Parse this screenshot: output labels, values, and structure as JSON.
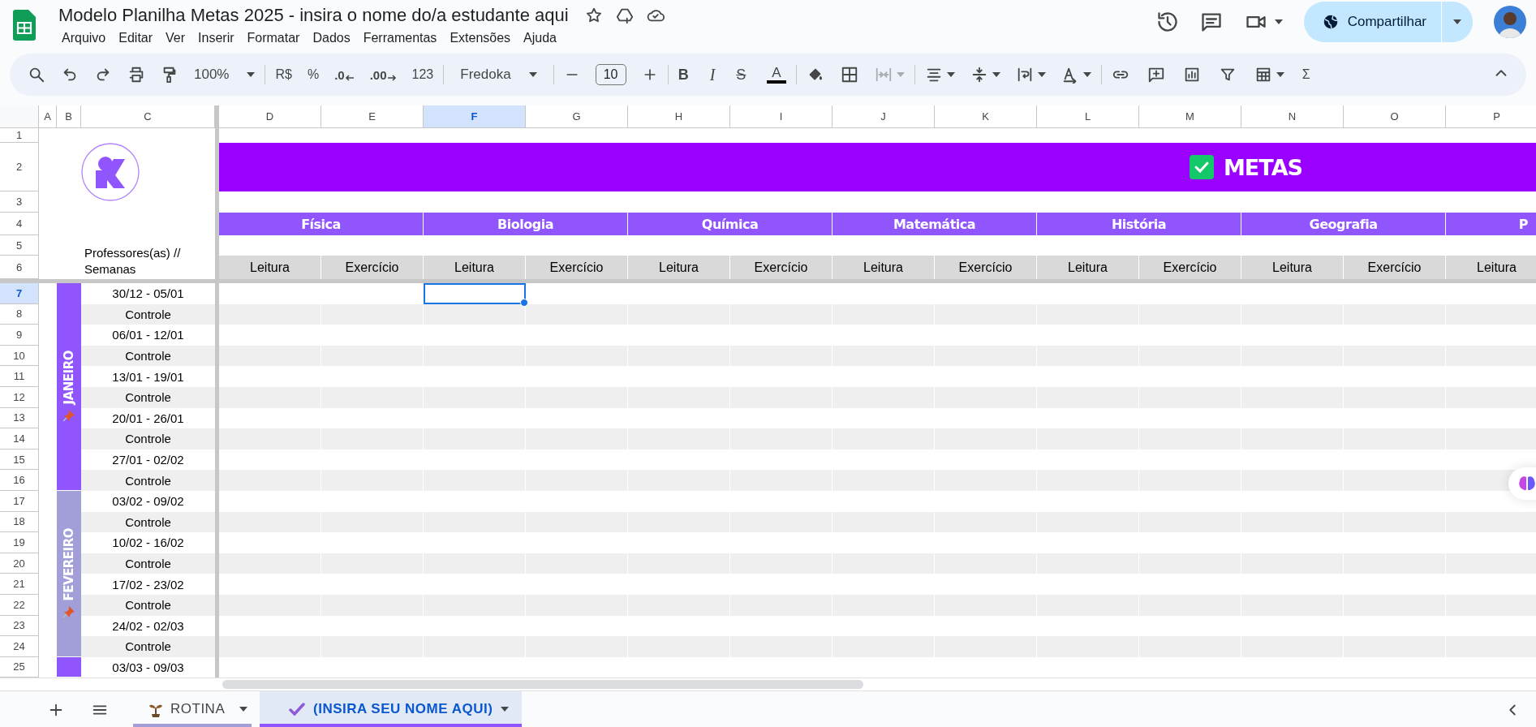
{
  "document": {
    "title": "Modelo Planilha Metas 2025 - insira o nome do/a estudante aqui"
  },
  "menu": [
    "Arquivo",
    "Editar",
    "Ver",
    "Inserir",
    "Formatar",
    "Dados",
    "Ferramentas",
    "Extensões",
    "Ajuda"
  ],
  "share_button": {
    "label": "Compartilhar"
  },
  "toolbar": {
    "zoom": "100%",
    "currency": "R$",
    "percent": "%",
    "decrease_decimals": ".0",
    "increase_decimals": ".00",
    "number_format": "123",
    "font": "Fredoka",
    "font_size": "10",
    "bold": "B",
    "italic": "I",
    "strikethrough": "S",
    "text_color": "A",
    "functions": "Σ"
  },
  "column_headers": [
    {
      "label": "A",
      "selected": false
    },
    {
      "label": "B",
      "selected": false
    },
    {
      "label": "C",
      "selected": false
    },
    {
      "label": "D",
      "selected": false
    },
    {
      "label": "E",
      "selected": false
    },
    {
      "label": "F",
      "selected": true
    },
    {
      "label": "G",
      "selected": false
    },
    {
      "label": "H",
      "selected": false
    },
    {
      "label": "I",
      "selected": false
    },
    {
      "label": "J",
      "selected": false
    },
    {
      "label": "K",
      "selected": false
    },
    {
      "label": "L",
      "selected": false
    },
    {
      "label": "M",
      "selected": false
    },
    {
      "label": "N",
      "selected": false
    },
    {
      "label": "O",
      "selected": false
    },
    {
      "label": "P",
      "selected": false
    }
  ],
  "row_headers": [
    {
      "label": "1",
      "selected": false
    },
    {
      "label": "2",
      "selected": false
    },
    {
      "label": "3",
      "selected": false
    },
    {
      "label": "4",
      "selected": false
    },
    {
      "label": "5",
      "selected": false
    },
    {
      "label": "6",
      "selected": false
    },
    {
      "label": "7",
      "selected": true
    },
    {
      "label": "8",
      "selected": false
    },
    {
      "label": "9",
      "selected": false
    },
    {
      "label": "10",
      "selected": false
    },
    {
      "label": "11",
      "selected": false
    },
    {
      "label": "12",
      "selected": false
    },
    {
      "label": "13",
      "selected": false
    },
    {
      "label": "14",
      "selected": false
    },
    {
      "label": "15",
      "selected": false
    },
    {
      "label": "16",
      "selected": false
    },
    {
      "label": "17",
      "selected": false
    },
    {
      "label": "18",
      "selected": false
    },
    {
      "label": "19",
      "selected": false
    },
    {
      "label": "20",
      "selected": false
    },
    {
      "label": "21",
      "selected": false
    },
    {
      "label": "22",
      "selected": false
    },
    {
      "label": "23",
      "selected": false
    },
    {
      "label": "24",
      "selected": false
    },
    {
      "label": "25",
      "selected": false
    }
  ],
  "sheet": {
    "banner": "METAS",
    "weeks_label": "Professores(as) // Semanas",
    "subjects": [
      {
        "name": "Física",
        "columns": [
          "Leitura",
          "Exercício"
        ]
      },
      {
        "name": "Biologia",
        "columns": [
          "Leitura",
          "Exercício"
        ]
      },
      {
        "name": "Química",
        "columns": [
          "Leitura",
          "Exercício"
        ]
      },
      {
        "name": "Matemática",
        "columns": [
          "Leitura",
          "Exercício"
        ]
      },
      {
        "name": "História",
        "columns": [
          "Leitura",
          "Exercício"
        ]
      },
      {
        "name": "Geografia",
        "columns": [
          "Leitura",
          "Exercício"
        ]
      },
      {
        "name": "P",
        "columns": [
          "Leitura"
        ]
      }
    ],
    "months": [
      {
        "label": "JANEIRO",
        "color": "#9155fd",
        "weeks": [
          {
            "label": "30/12 - 05/01",
            "kind": "week"
          },
          {
            "label": "Controle",
            "kind": "control"
          },
          {
            "label": "06/01 - 12/01",
            "kind": "week"
          },
          {
            "label": "Controle",
            "kind": "control"
          },
          {
            "label": "13/01 - 19/01",
            "kind": "week"
          },
          {
            "label": "Controle",
            "kind": "control"
          },
          {
            "label": "20/01 - 26/01",
            "kind": "week"
          },
          {
            "label": "Controle",
            "kind": "control"
          },
          {
            "label": "27/01 - 02/02",
            "kind": "week"
          },
          {
            "label": "Controle",
            "kind": "control"
          }
        ]
      },
      {
        "label": "FEVEREIRO",
        "color": "#a29fd8",
        "weeks": [
          {
            "label": "03/02 - 09/02",
            "kind": "week"
          },
          {
            "label": "Controle",
            "kind": "control"
          },
          {
            "label": "10/02 - 16/02",
            "kind": "week"
          },
          {
            "label": "Controle",
            "kind": "control"
          },
          {
            "label": "17/02 - 23/02",
            "kind": "week"
          },
          {
            "label": "Controle",
            "kind": "control"
          },
          {
            "label": "24/02 - 02/03",
            "kind": "week"
          },
          {
            "label": "Controle",
            "kind": "control"
          }
        ]
      },
      {
        "color": "#9155fd",
        "weeks": [
          {
            "label": "03/03 - 09/03",
            "kind": "week"
          }
        ]
      }
    ]
  },
  "sheet_tabs": [
    {
      "label": "ROTINA",
      "color": "#a29fd8",
      "selected": false
    },
    {
      "label": "(INSIRA SEU NOME AQUI)",
      "color": "#9155fd",
      "selected": true
    }
  ]
}
